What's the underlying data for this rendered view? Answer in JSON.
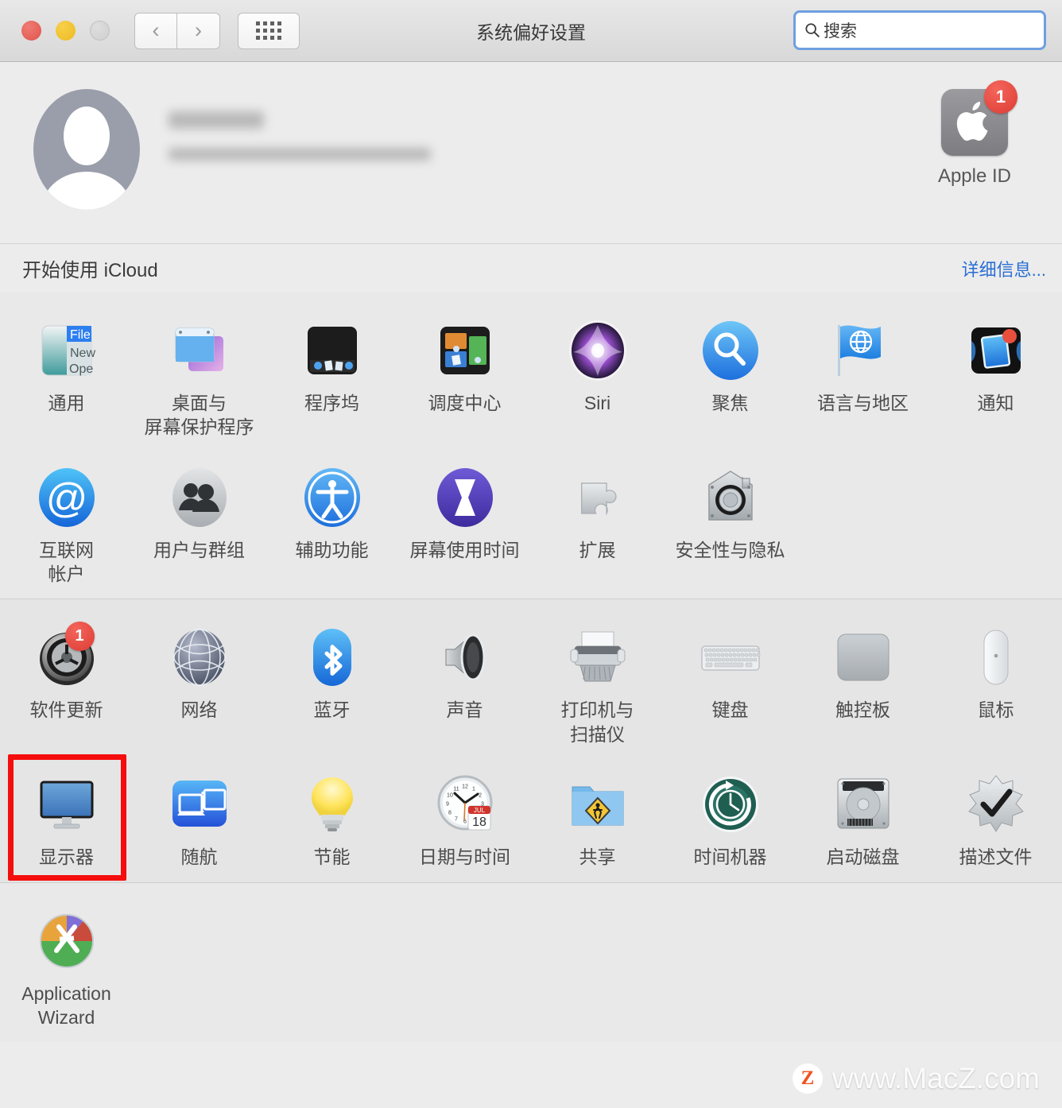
{
  "window": {
    "title": "系统偏好设置",
    "traffic_lights": [
      "close",
      "minimize",
      "zoom"
    ],
    "nav_back": "‹",
    "nav_forward": "›",
    "grid_button": "show-all-grid"
  },
  "search": {
    "placeholder": "搜索",
    "value": "",
    "icon": "search-icon"
  },
  "account": {
    "name_redacted": "",
    "detail_redacted": "",
    "apple_id_label": "Apple ID",
    "apple_id_badge": "1",
    "avatar_icon": "user-avatar-icon"
  },
  "icloud": {
    "label": "开始使用 iCloud",
    "link": "详细信息..."
  },
  "colors": {
    "accent_link": "#2a6ed4",
    "badge_red": "#dc3c33",
    "highlight_red": "#f50d0d",
    "window_bg": "#ececec",
    "section_bg": "#e9e9e9",
    "section_alt_bg": "#e5e5e5"
  },
  "sections": [
    {
      "name": "personal",
      "items": [
        {
          "label": "通用",
          "icon": "general-icon",
          "badge": null
        },
        {
          "label": "桌面与\n屏幕保护程序",
          "icon": "desktop-screensaver-icon",
          "badge": null
        },
        {
          "label": "程序坞",
          "icon": "dock-icon",
          "badge": null
        },
        {
          "label": "调度中心",
          "icon": "mission-control-icon",
          "badge": null
        },
        {
          "label": "Siri",
          "icon": "siri-icon",
          "badge": null
        },
        {
          "label": "聚焦",
          "icon": "spotlight-icon",
          "badge": null
        },
        {
          "label": "语言与地区",
          "icon": "language-region-icon",
          "badge": null
        },
        {
          "label": "通知",
          "icon": "notifications-icon",
          "badge": null
        },
        {
          "label": "互联网\n帐户",
          "icon": "internet-accounts-icon",
          "badge": null
        },
        {
          "label": "用户与群组",
          "icon": "users-groups-icon",
          "badge": null
        },
        {
          "label": "辅助功能",
          "icon": "accessibility-icon",
          "badge": null
        },
        {
          "label": "屏幕使用时间",
          "icon": "screen-time-icon",
          "badge": null
        },
        {
          "label": "扩展",
          "icon": "extensions-icon",
          "badge": null
        },
        {
          "label": "安全性与隐私",
          "icon": "security-privacy-icon",
          "badge": null
        }
      ]
    },
    {
      "name": "hardware",
      "items": [
        {
          "label": "软件更新",
          "icon": "software-update-icon",
          "badge": "1"
        },
        {
          "label": "网络",
          "icon": "network-icon",
          "badge": null
        },
        {
          "label": "蓝牙",
          "icon": "bluetooth-icon",
          "badge": null
        },
        {
          "label": "声音",
          "icon": "sound-icon",
          "badge": null
        },
        {
          "label": "打印机与\n扫描仪",
          "icon": "printers-scanners-icon",
          "badge": null
        },
        {
          "label": "键盘",
          "icon": "keyboard-icon",
          "badge": null
        },
        {
          "label": "触控板",
          "icon": "trackpad-icon",
          "badge": null
        },
        {
          "label": "鼠标",
          "icon": "mouse-icon",
          "badge": null
        },
        {
          "label": "显示器",
          "icon": "displays-icon",
          "badge": null,
          "highlighted": true
        },
        {
          "label": "随航",
          "icon": "sidecar-icon",
          "badge": null
        },
        {
          "label": "节能",
          "icon": "energy-saver-icon",
          "badge": null
        },
        {
          "label": "日期与时间",
          "icon": "date-time-icon",
          "badge": null
        },
        {
          "label": "共享",
          "icon": "sharing-icon",
          "badge": null
        },
        {
          "label": "时间机器",
          "icon": "time-machine-icon",
          "badge": null
        },
        {
          "label": "启动磁盘",
          "icon": "startup-disk-icon",
          "badge": null
        },
        {
          "label": "描述文件",
          "icon": "profiles-icon",
          "badge": null
        }
      ]
    },
    {
      "name": "other",
      "items": [
        {
          "label": "Application\nWizard",
          "icon": "application-wizard-icon",
          "badge": null
        }
      ]
    }
  ],
  "watermark": {
    "logo": "Z",
    "text": "www.MacZ.com"
  }
}
